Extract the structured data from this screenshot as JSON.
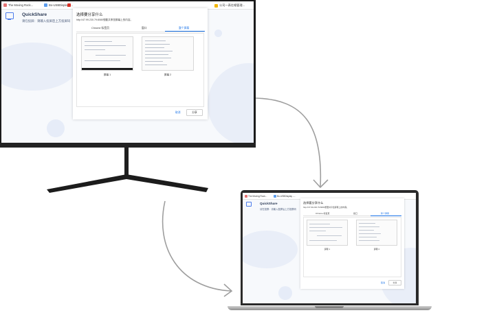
{
  "bookmarks": [
    {
      "label": "The Moving Rock..."
    },
    {
      "label": "Bo-USBDisplay -..."
    },
    {
      "label": "公司一表往格管理..."
    }
  ],
  "app": {
    "name": "QuickShare",
    "subtitle": "请在投屏：请输入投屏后上方投屏码"
  },
  "dialog": {
    "title": "选择要分享什么",
    "description": "http://47.99.230.79:8080想要共享您屏幕上的内容。",
    "tabs": [
      {
        "label": "Chrome 标签页",
        "active": false
      },
      {
        "label": "窗口",
        "active": false
      },
      {
        "label": "整个屏幕",
        "active": true
      }
    ],
    "screens": [
      {
        "label": "屏幕 1"
      },
      {
        "label": "屏幕 2"
      }
    ],
    "cancel_label": "取消",
    "share_label": "分享"
  },
  "colors": {
    "accent": "#1a73e8",
    "brand": "#4b7bec",
    "arrow": "#9e9e9e"
  }
}
